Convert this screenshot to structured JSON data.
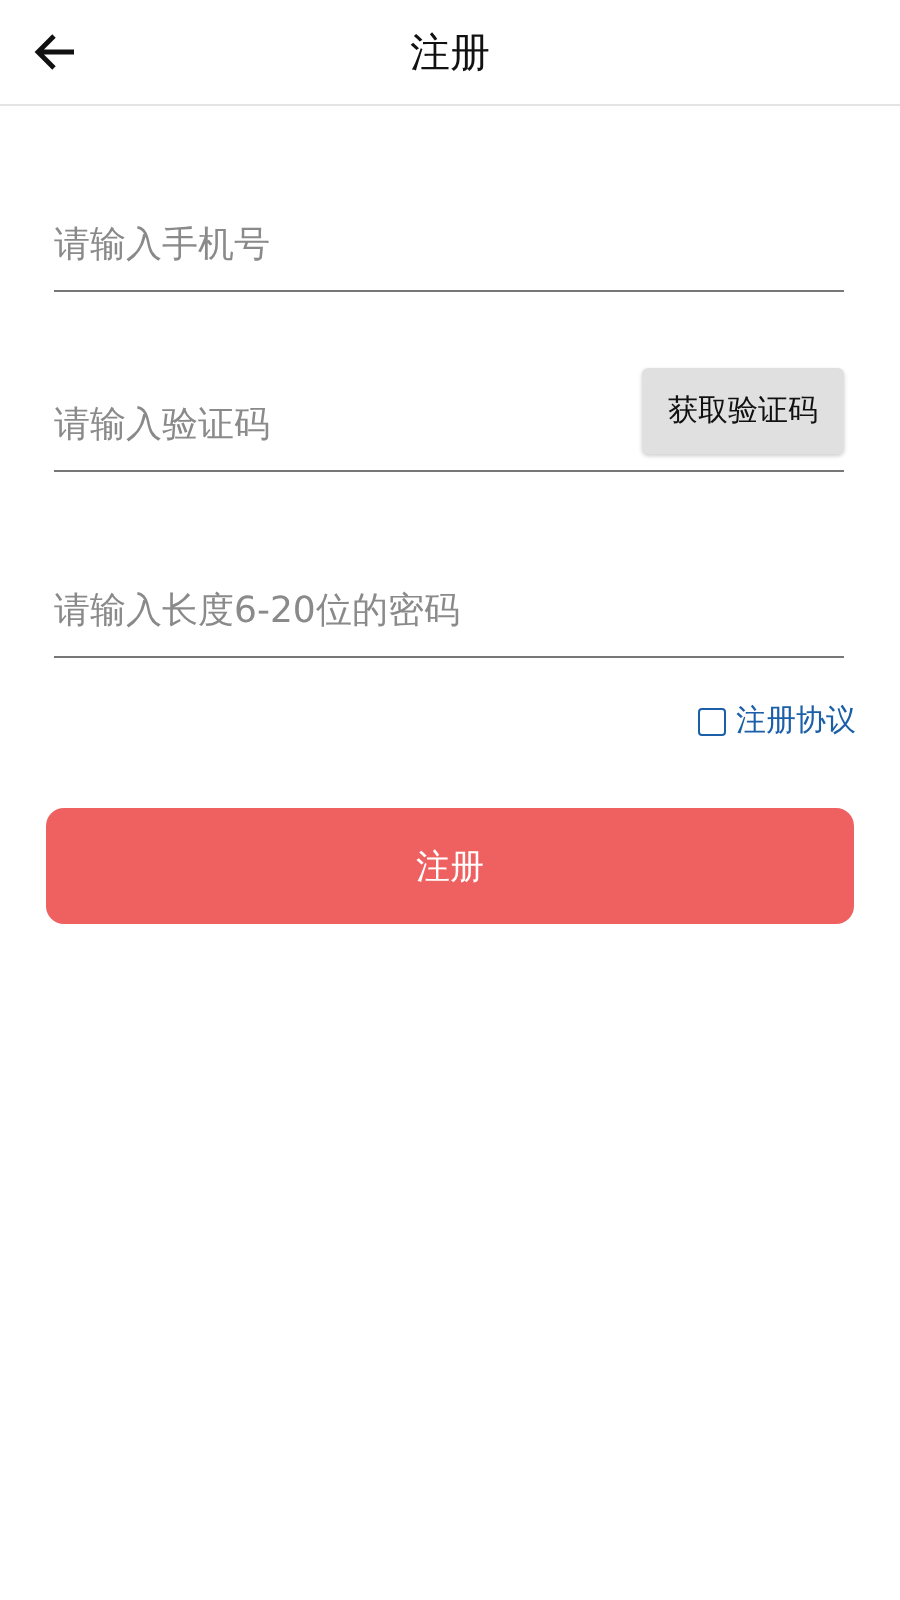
{
  "header": {
    "title": "注册"
  },
  "fields": [
    {
      "kind": "plain",
      "placeholder": "请输入手机号"
    },
    {
      "kind": "code",
      "placeholder": "请输入验证码",
      "button": "获取验证码"
    },
    {
      "kind": "plain",
      "placeholder": "请输入长度6-20位的密码"
    }
  ],
  "agreement": {
    "label": "注册协议",
    "checked": false
  },
  "submit": "注册"
}
